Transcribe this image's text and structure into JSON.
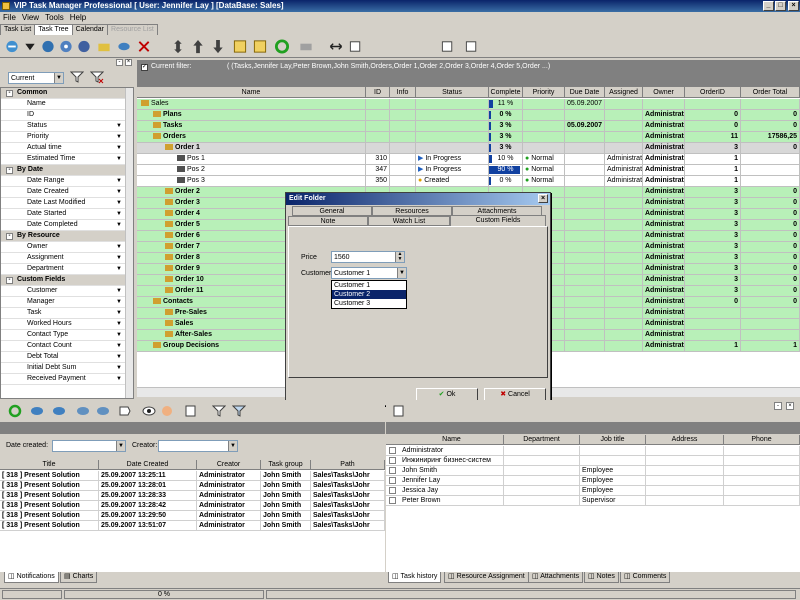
{
  "window": {
    "title": "VIP Task Manager Professional [ User: Jennifer Lay ] [DataBase: Sales]",
    "min": "_",
    "max": "□",
    "close": "×"
  },
  "menu": [
    "File",
    "View",
    "Tools",
    "Help"
  ],
  "tabs": [
    {
      "label": "Task List",
      "state": "normal"
    },
    {
      "label": "Task Tree",
      "state": "active"
    },
    {
      "label": "Calendar",
      "state": "normal"
    },
    {
      "label": "Resource List",
      "state": "disabled"
    }
  ],
  "left": {
    "view_combo": "Current",
    "sections": [
      {
        "title": "Common",
        "items": [
          "Name",
          "ID",
          "Status",
          "Priority",
          "Actual time",
          "Estimated Time"
        ]
      },
      {
        "title": "By Date",
        "items": [
          "Date Range",
          "Date Created",
          "Date Last Modified",
          "Date Started",
          "Date Completed"
        ]
      },
      {
        "title": "By Resource",
        "items": [
          "Owner",
          "Assignment",
          "Department"
        ]
      },
      {
        "title": "Custom Fields",
        "items": [
          "Customer",
          "Manager",
          "Task",
          "Worked Hours",
          "Contact Type",
          "Contact Count",
          "Debt Total",
          "Initial Debt Sum",
          "Received Payment"
        ]
      }
    ]
  },
  "filter": {
    "label": "Current filter:",
    "value": "( (Tasks,Jennifer Lay,Peter Brown,John Smith,Orders,Order 1,Order 2,Order 3,Order 4,Order 5,Order ...)"
  },
  "grid": {
    "headers": [
      "Name",
      "ID",
      "Info",
      "Status",
      "Complete",
      "Priority",
      "Due Date",
      "Assigned",
      "Owner",
      "OrderID",
      "Order Total"
    ],
    "rows": [
      {
        "name": "Sales",
        "indent": 0,
        "bg": "green",
        "bold": false,
        "id": "",
        "status": "",
        "complete": "11 %",
        "priority": "",
        "due": "05.09.2007",
        "assigned": "",
        "owner": "",
        "orderid": "",
        "total": ""
      },
      {
        "name": "Plans",
        "indent": 1,
        "bg": "green",
        "bold": true,
        "id": "",
        "status": "",
        "complete": "0 %",
        "priority": "",
        "due": "",
        "assigned": "",
        "owner": "Administrat",
        "orderid": "0",
        "total": "0"
      },
      {
        "name": "Tasks",
        "indent": 1,
        "bg": "green",
        "bold": true,
        "id": "",
        "status": "",
        "complete": "3 %",
        "priority": "",
        "due": "05.09.2007",
        "assigned": "",
        "owner": "Administrat",
        "orderid": "0",
        "total": "0"
      },
      {
        "name": "Orders",
        "indent": 1,
        "bg": "green",
        "bold": true,
        "id": "",
        "status": "",
        "complete": "3 %",
        "priority": "",
        "due": "",
        "assigned": "",
        "owner": "Administrat",
        "orderid": "11",
        "total": "17586,25"
      },
      {
        "name": "Order 1",
        "indent": 2,
        "bg": "gray",
        "bold": true,
        "id": "",
        "status": "",
        "complete": "3 %",
        "priority": "",
        "due": "",
        "assigned": "",
        "owner": "Administrat",
        "orderid": "3",
        "total": "0"
      },
      {
        "name": "Pos 1",
        "indent": 3,
        "bg": "white",
        "bold": false,
        "id": "310",
        "status": "In Progress",
        "complete": "10 %",
        "priority": "Normal",
        "due": "",
        "assigned": "Administrat",
        "owner": "Administrator",
        "orderid": "1",
        "total": ""
      },
      {
        "name": "Pos 2",
        "indent": 3,
        "bg": "white",
        "bold": false,
        "id": "347",
        "status": "In Progress",
        "complete": "90 %",
        "priority": "Normal",
        "due": "",
        "assigned": "Administrat",
        "owner": "Administrator",
        "orderid": "1",
        "total": ""
      },
      {
        "name": "Pos 3",
        "indent": 3,
        "bg": "white",
        "bold": false,
        "id": "350",
        "status": "Created",
        "complete": "0 %",
        "priority": "Normal",
        "due": "",
        "assigned": "Administrat",
        "owner": "Administrator",
        "orderid": "1",
        "total": ""
      },
      {
        "name": "Order 2",
        "indent": 2,
        "bg": "green",
        "bold": true,
        "id": "",
        "status": "",
        "complete": "",
        "priority": "",
        "due": "",
        "assigned": "",
        "owner": "Administrat",
        "orderid": "3",
        "total": "0"
      },
      {
        "name": "Order 3",
        "indent": 2,
        "bg": "green",
        "bold": true,
        "id": "",
        "status": "",
        "complete": "",
        "priority": "",
        "due": "",
        "assigned": "",
        "owner": "Administrat",
        "orderid": "3",
        "total": "0"
      },
      {
        "name": "Order 4",
        "indent": 2,
        "bg": "green",
        "bold": true,
        "id": "",
        "status": "",
        "complete": "",
        "priority": "",
        "due": "",
        "assigned": "",
        "owner": "Administrat",
        "orderid": "3",
        "total": "0"
      },
      {
        "name": "Order 5",
        "indent": 2,
        "bg": "green",
        "bold": true,
        "id": "",
        "status": "",
        "complete": "",
        "priority": "",
        "due": "",
        "assigned": "",
        "owner": "Administrat",
        "orderid": "3",
        "total": "0"
      },
      {
        "name": "Order 6",
        "indent": 2,
        "bg": "green",
        "bold": true,
        "id": "",
        "status": "",
        "complete": "",
        "priority": "",
        "due": "",
        "assigned": "",
        "owner": "Administrat",
        "orderid": "3",
        "total": "0"
      },
      {
        "name": "Order 7",
        "indent": 2,
        "bg": "green",
        "bold": true,
        "id": "",
        "status": "",
        "complete": "",
        "priority": "",
        "due": "",
        "assigned": "",
        "owner": "Administrat",
        "orderid": "3",
        "total": "0"
      },
      {
        "name": "Order 8",
        "indent": 2,
        "bg": "green",
        "bold": true,
        "id": "",
        "status": "",
        "complete": "",
        "priority": "",
        "due": "",
        "assigned": "",
        "owner": "Administrat",
        "orderid": "3",
        "total": "0"
      },
      {
        "name": "Order 9",
        "indent": 2,
        "bg": "green",
        "bold": true,
        "id": "",
        "status": "",
        "complete": "",
        "priority": "",
        "due": "",
        "assigned": "",
        "owner": "Administrat",
        "orderid": "3",
        "total": "0"
      },
      {
        "name": "Order 10",
        "indent": 2,
        "bg": "green",
        "bold": true,
        "id": "",
        "status": "",
        "complete": "",
        "priority": "",
        "due": "",
        "assigned": "",
        "owner": "Administrat",
        "orderid": "3",
        "total": "0"
      },
      {
        "name": "Order 11",
        "indent": 2,
        "bg": "green",
        "bold": true,
        "id": "",
        "status": "",
        "complete": "",
        "priority": "",
        "due": "",
        "assigned": "",
        "owner": "Administrat",
        "orderid": "3",
        "total": "0"
      },
      {
        "name": "Contacts",
        "indent": 1,
        "bg": "green",
        "bold": true,
        "id": "",
        "status": "",
        "complete": "",
        "priority": "",
        "due": "",
        "assigned": "",
        "owner": "Administrat",
        "orderid": "0",
        "total": "0"
      },
      {
        "name": "Pre-Sales",
        "indent": 2,
        "bg": "green",
        "bold": true,
        "id": "",
        "status": "",
        "complete": "",
        "priority": "",
        "due": "",
        "assigned": "",
        "owner": "Administrat",
        "orderid": "",
        "total": ""
      },
      {
        "name": "Sales",
        "indent": 2,
        "bg": "green",
        "bold": true,
        "id": "",
        "status": "",
        "complete": "",
        "priority": "",
        "due": "",
        "assigned": "",
        "owner": "Administrat",
        "orderid": "",
        "total": ""
      },
      {
        "name": "After-Sales",
        "indent": 2,
        "bg": "green",
        "bold": true,
        "id": "",
        "status": "",
        "complete": "",
        "priority": "",
        "due": "",
        "assigned": "",
        "owner": "Administrat",
        "orderid": "",
        "total": ""
      },
      {
        "name": "Group Decisions",
        "indent": 1,
        "bg": "green",
        "bold": true,
        "id": "",
        "status": "",
        "complete": "",
        "priority": "",
        "due": "",
        "assigned": "",
        "owner": "Administrat",
        "orderid": "1",
        "total": "1"
      }
    ]
  },
  "dialog": {
    "title": "Edit Folder",
    "close": "×",
    "tabs_row1": [
      "General",
      "Resources",
      "Attachments"
    ],
    "tabs_row2": [
      "Note",
      "Watch List",
      "Custom Fields"
    ],
    "price_label": "Price",
    "price_value": "1560",
    "customer_label": "Customer",
    "customer_value": "Customer 1",
    "customer_options": [
      "Customer 1",
      "Customer 2",
      "Customer 3"
    ],
    "customer_highlighted": "Customer 2",
    "ok": "Ok",
    "cancel": "Cancel"
  },
  "bottom_left": {
    "date_created_label": "Date created:",
    "creator_label": "Creator:",
    "headers": [
      "Title",
      "Date Created",
      "Creator",
      "Task group",
      "Path"
    ],
    "rows": [
      [
        "[ 318 ] Present Solution",
        "25.09.2007 13:25:11",
        "Administrator",
        "John Smith",
        "Sales\\Tasks\\Johr"
      ],
      [
        "[ 318 ] Present Solution",
        "25.09.2007 13:28:01",
        "Administrator",
        "John Smith",
        "Sales\\Tasks\\Johr"
      ],
      [
        "[ 318 ] Present Solution",
        "25.09.2007 13:28:33",
        "Administrator",
        "John Smith",
        "Sales\\Tasks\\Johr"
      ],
      [
        "[ 318 ] Present Solution",
        "25.09.2007 13:28:42",
        "Administrator",
        "John Smith",
        "Sales\\Tasks\\Johr"
      ],
      [
        "[ 318 ] Present Solution",
        "25.09.2007 13:29:50",
        "Administrator",
        "John Smith",
        "Sales\\Tasks\\Johr"
      ],
      [
        "[ 318 ] Present Solution",
        "25.09.2007 13:51:07",
        "Administrator",
        "John Smith",
        "Sales\\Tasks\\Johr"
      ]
    ],
    "tabs": [
      "Notifications",
      "Charts"
    ]
  },
  "bottom_right": {
    "headers": [
      "Name",
      "Department",
      "Job title",
      "Address",
      "Phone"
    ],
    "rows": [
      [
        "Administrator",
        "",
        "",
        "",
        ""
      ],
      [
        "Инжиниринг бизнес-систем",
        "",
        "",
        "",
        ""
      ],
      [
        "John Smith",
        "",
        "Employee",
        "",
        ""
      ],
      [
        "Jennifer Lay",
        "",
        "Employee",
        "",
        ""
      ],
      [
        "Jessica Jay",
        "",
        "Employee",
        "",
        ""
      ],
      [
        "Peter Brown",
        "",
        "Supervisor",
        "",
        ""
      ]
    ],
    "tabs": [
      "Task history",
      "Resource Assignment",
      "Attachments",
      "Notes",
      "Comments"
    ]
  },
  "status": {
    "progress": "0 %"
  }
}
